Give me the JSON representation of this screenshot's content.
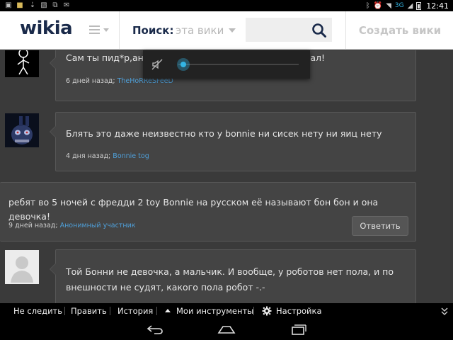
{
  "status_bar": {
    "network": "3G",
    "time": "12:41"
  },
  "header": {
    "logo": "wikia",
    "search_label": "Поиск:",
    "search_scope": "эта вики",
    "search_placeholder": "",
    "create_wiki": "Создать вики"
  },
  "comments": [
    {
      "text": "Сам ты пид*р,ано",
      "text_tail": "вал!",
      "time": "6 дней назад;",
      "user": "TheHoRReSFeeD"
    },
    {
      "text": "Блять это даже неизвестно кто у bonnie ни сисек нету ни яиц нету",
      "time": "4 дня назад;",
      "user": "Bonnie tog"
    },
    {
      "text": "ребят во 5 ночей с фредди 2 toy Bonnie на русском её называют бон бон и она девочка!",
      "time": "9 дней назад;",
      "user": "Анонимный участник",
      "reply": "Ответить"
    },
    {
      "text_line1": "Той Бонни не девочка, а мальчик. И вообще, у роботов нет пола, и по",
      "text_line2": "внешности не судят, какого пола робот -.-"
    }
  ],
  "volume": {
    "level": 0.04,
    "muted": true
  },
  "toolbar": {
    "unfollow": "Не следить",
    "edit": "Править",
    "history": "История",
    "my_tools": "Мои инструменты",
    "customize": "Настройка"
  },
  "colors": {
    "accent": "#33b5e5",
    "link": "#4f9fd8",
    "logo": "#1a2a4a"
  }
}
